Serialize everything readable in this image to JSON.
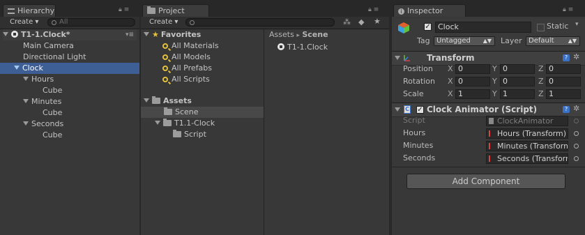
{
  "hierarchy": {
    "tab_label": "Hierarchy",
    "create_label": "Create",
    "search_placeholder": "All",
    "scene_name": "T1-1.Clock*",
    "items": [
      {
        "label": "Main Camera"
      },
      {
        "label": "Directional Light"
      },
      {
        "label": "Clock"
      },
      {
        "label": "Hours"
      },
      {
        "label": "Cube"
      },
      {
        "label": "Minutes"
      },
      {
        "label": "Cube"
      },
      {
        "label": "Seconds"
      },
      {
        "label": "Cube"
      }
    ]
  },
  "project": {
    "tab_label": "Project",
    "create_label": "Create",
    "favorites": {
      "label": "Favorites",
      "items": [
        {
          "label": "All Materials"
        },
        {
          "label": "All Models"
        },
        {
          "label": "All Prefabs"
        },
        {
          "label": "All Scripts"
        }
      ]
    },
    "assets": {
      "label": "Assets",
      "items": [
        {
          "label": "Scene"
        },
        {
          "label": "T1.1-Clock"
        },
        {
          "label": "Script"
        }
      ]
    },
    "breadcrumb": {
      "root": "Assets",
      "separator": "▸",
      "current": "Scene"
    },
    "files": [
      {
        "label": "T1-1.Clock"
      }
    ]
  },
  "inspector": {
    "tab_label": "Inspector",
    "object_name": "Clock",
    "static_label": "Static",
    "tag_label": "Tag",
    "tag_value": "Untagged",
    "layer_label": "Layer",
    "layer_value": "Default",
    "transform": {
      "title": "Transform",
      "rows": [
        {
          "label": "Position",
          "x": "0",
          "y": "0",
          "z": "0"
        },
        {
          "label": "Rotation",
          "x": "0",
          "y": "0",
          "z": "0"
        },
        {
          "label": "Scale",
          "x": "1",
          "y": "1",
          "z": "1"
        }
      ],
      "axes": {
        "x": "X",
        "y": "Y",
        "z": "Z"
      }
    },
    "clock_animator": {
      "title": "Clock Animator (Script)",
      "fields": [
        {
          "label": "Script",
          "value": "ClockAnimator"
        },
        {
          "label": "Hours",
          "value": "Hours (Transform)"
        },
        {
          "label": "Minutes",
          "value": "Minutes (Transform)"
        },
        {
          "label": "Seconds",
          "value": "Seconds (Transform)"
        }
      ]
    },
    "add_component_label": "Add Component"
  },
  "colors": {
    "selection": "#3e5f96",
    "panel_bg": "#383838",
    "background": "#282828",
    "accent_yellow": "#e4c23c"
  }
}
